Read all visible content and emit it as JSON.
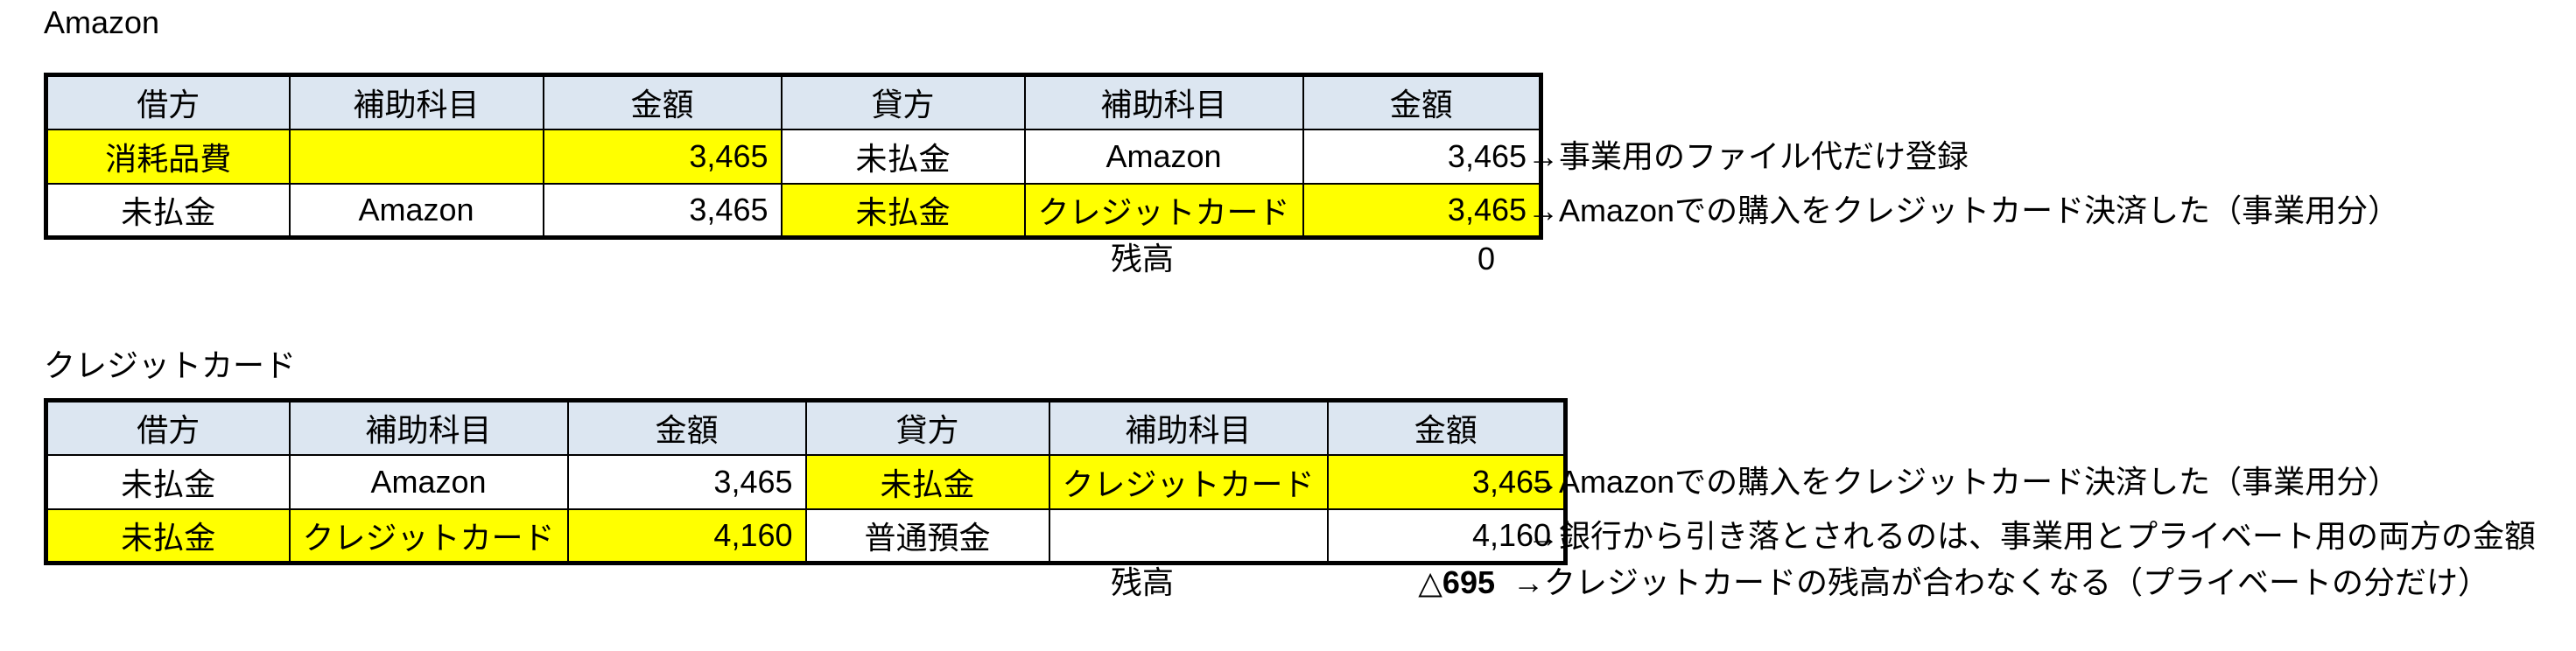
{
  "columns": [
    "借方",
    "補助科目",
    "金額",
    "貸方",
    "補助科目",
    "金額"
  ],
  "sections": [
    {
      "title": "Amazon",
      "rows": [
        {
          "debit_account": "消耗品費",
          "debit_sub": "",
          "debit_amount": "3,465",
          "credit_account": "未払金",
          "credit_sub": "Amazon",
          "credit_amount": "3,465",
          "note": "→事業用のファイル代だけ登録"
        },
        {
          "debit_account": "未払金",
          "debit_sub": "Amazon",
          "debit_amount": "3,465",
          "credit_account": "未払金",
          "credit_sub": "クレジットカード",
          "credit_amount": "3,465",
          "note": "→Amazonでの購入をクレジットカード決済した（事業用分）"
        }
      ],
      "balance_label": "残高",
      "balance_value": "0",
      "balance_note": ""
    },
    {
      "title": "クレジットカード",
      "rows": [
        {
          "debit_account": "未払金",
          "debit_sub": "Amazon",
          "debit_amount": "3,465",
          "credit_account": "未払金",
          "credit_sub": "クレジットカード",
          "credit_amount": "3,465",
          "note": "→Amazonでの購入をクレジットカード決済した（事業用分）"
        },
        {
          "debit_account": "未払金",
          "debit_sub": "クレジットカード",
          "debit_amount": "4,160",
          "credit_account": "普通預金",
          "credit_sub": "",
          "credit_amount": "4,160",
          "note": "→銀行から引き落とされるのは、事業用とプライベート用の両方の金額"
        }
      ],
      "balance_label": "残高",
      "balance_value": "△695",
      "balance_note": "→クレジットカードの残高が合わなくなる（プライベートの分だけ）"
    }
  ],
  "colors": {
    "header_fill": "#dce6f1",
    "highlight_fill": "#ffff00",
    "border": "#000000",
    "text": "#000000"
  }
}
